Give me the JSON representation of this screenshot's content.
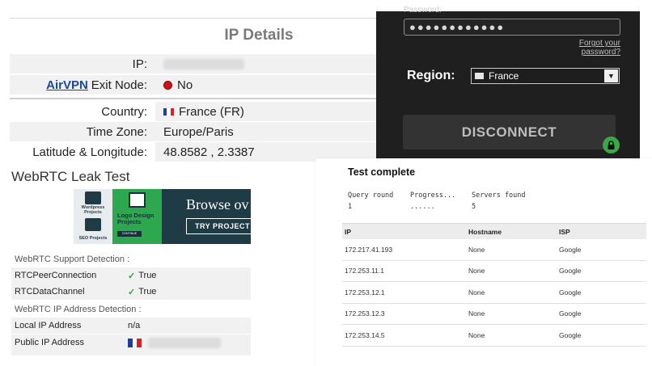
{
  "ip_details": {
    "title": "IP Details",
    "ip_label": "IP:",
    "airvpn_link": "AirVPN",
    "exit_node_label": "Exit Node:",
    "exit_node_value": "No",
    "country_label": "Country:",
    "country_value": "France (FR)",
    "timezone_label": "Time Zone:",
    "timezone_value": "Europe/Paris",
    "latlong_label": "Latitude & Longitude:",
    "latlong_value": "48.8582 , 2.3387"
  },
  "vpn_app": {
    "password_label": "Password:",
    "password_value": "●●●●●●●●●●●●",
    "forgot_link": "Forgot your password?",
    "region_label": "Region:",
    "region_value": "France",
    "disconnect_label": "DISCONNECT",
    "status_color": "#3aa847"
  },
  "webrtc": {
    "title": "WebRTC Leak Test",
    "ad": {
      "tile1_caption": "Wordpress Projects",
      "tile2_caption": "SEO Projects",
      "mid_text": "Logo Design Projects",
      "mid_button": "CONTINUE",
      "headline": "Browse ov",
      "cta": "TRY PROJECT"
    },
    "support_heading": "WebRTC Support Detection :",
    "peer_label": "RTCPeerConnection",
    "peer_value": "True",
    "datachannel_label": "RTCDataChannel",
    "datachannel_value": "True",
    "ip_heading": "WebRTC IP Address Detection :",
    "local_label": "Local IP Address",
    "local_value": "n/a",
    "public_label": "Public IP Address"
  },
  "dns_test": {
    "title": "Test complete",
    "query_round_label": "Query round",
    "query_round_value": "1",
    "progress_label": "Progress...",
    "progress_value": "......",
    "servers_found_label": "Servers found",
    "servers_found_value": "5",
    "columns": [
      "IP",
      "Hostname",
      "ISP"
    ],
    "rows": [
      [
        "172.217.41.193",
        "None",
        "Google"
      ],
      [
        "172.253.11.1",
        "None",
        "Google"
      ],
      [
        "172.253.12.1",
        "None",
        "Google"
      ],
      [
        "172.253.12.3",
        "None",
        "Google"
      ],
      [
        "172.253.14.5",
        "None",
        "Google"
      ]
    ]
  },
  "colors": {
    "link_blue": "#1a47a6",
    "status_red": "#c8141c",
    "check_green": "#33a036",
    "vpn_bg": "#1f1f1f"
  }
}
